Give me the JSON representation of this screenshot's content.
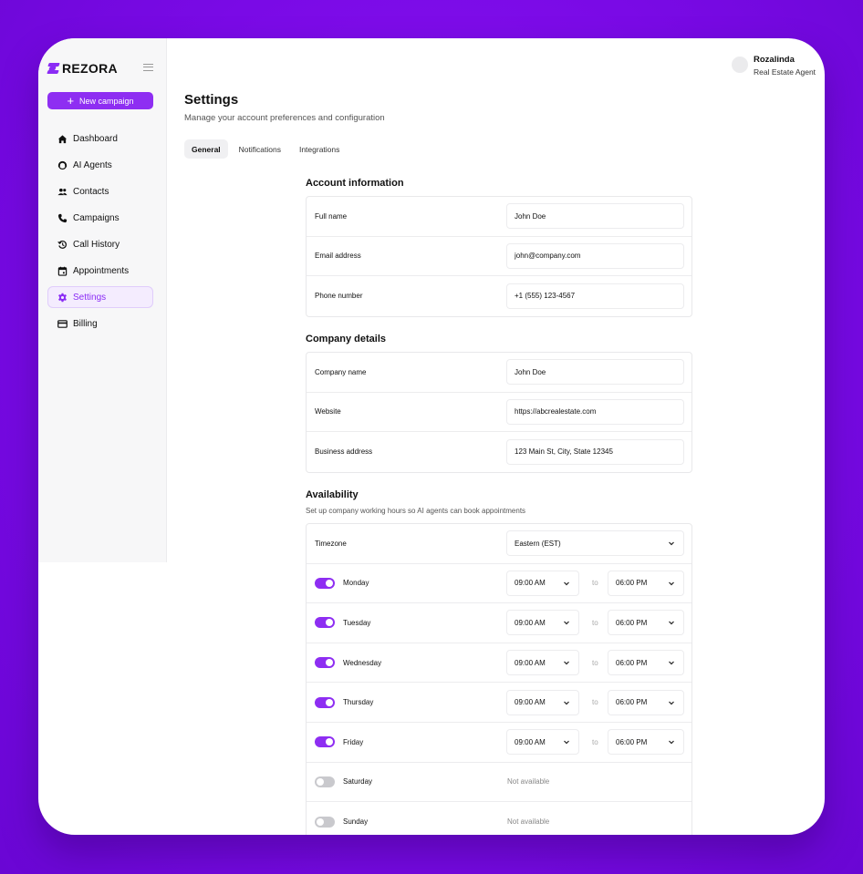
{
  "brand": {
    "name": "REZORA",
    "accent": "#8e2ef2"
  },
  "sidebar": {
    "new_campaign_label": "New campaign",
    "items": [
      {
        "label": "Dashboard",
        "icon": "home-icon"
      },
      {
        "label": "AI Agents",
        "icon": "agent-icon"
      },
      {
        "label": "Contacts",
        "icon": "contacts-icon"
      },
      {
        "label": "Campaigns",
        "icon": "phone-icon"
      },
      {
        "label": "Call History",
        "icon": "history-icon"
      },
      {
        "label": "Appointments",
        "icon": "calendar-icon"
      },
      {
        "label": "Settings",
        "icon": "gear-icon",
        "active": true
      },
      {
        "label": "Billing",
        "icon": "card-icon"
      }
    ]
  },
  "user": {
    "name": "Rozalinda",
    "role": "Real Estate Agent"
  },
  "page": {
    "title": "Settings",
    "subtitle": "Manage your account preferences and configuration",
    "tabs": [
      "General",
      "Notifications",
      "Integrations"
    ],
    "active_tab": "General"
  },
  "account": {
    "title": "Account information",
    "fields": [
      {
        "label": "Full name",
        "value": "John Doe"
      },
      {
        "label": "Email address",
        "value": "john@company.com"
      },
      {
        "label": "Phone number",
        "value": "+1 (555) 123-4567"
      }
    ]
  },
  "company": {
    "title": "Company details",
    "fields": [
      {
        "label": "Company name",
        "value": "John Doe"
      },
      {
        "label": "Website",
        "value": "https://abcrealestate.com"
      },
      {
        "label": "Business address",
        "value": "123 Main St, City, State 12345"
      }
    ]
  },
  "availability": {
    "title": "Availability",
    "subtitle": "Set up company working hours so AI agents can book appointments",
    "timezone_label": "Timezone",
    "timezone_value": "Eastern (EST)",
    "to_label": "to",
    "not_available_label": "Not available",
    "days": [
      {
        "label": "Monday",
        "enabled": true,
        "start": "09:00 AM",
        "end": "06:00 PM"
      },
      {
        "label": "Tuesday",
        "enabled": true,
        "start": "09:00 AM",
        "end": "06:00 PM"
      },
      {
        "label": "Wednesday",
        "enabled": true,
        "start": "09:00 AM",
        "end": "06:00 PM"
      },
      {
        "label": "Thursday",
        "enabled": true,
        "start": "09:00 AM",
        "end": "06:00 PM"
      },
      {
        "label": "Friday",
        "enabled": true,
        "start": "09:00 AM",
        "end": "06:00 PM"
      },
      {
        "label": "Saturday",
        "enabled": false
      },
      {
        "label": "Sunday",
        "enabled": false
      }
    ]
  }
}
